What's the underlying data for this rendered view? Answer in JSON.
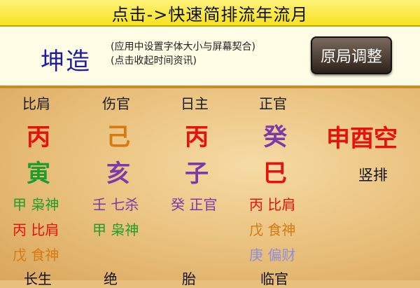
{
  "top_bar": {
    "label": "点击->快速简排流年流月"
  },
  "info_panel": {
    "title": "坤造",
    "note_line1": "(应用中设置字体大小与屏幕契合)",
    "note_line2": "(点击收起时间资讯)",
    "adjust_button": "原局调整"
  },
  "pillars": [
    {
      "header": "比肩",
      "stem": {
        "char": "丙",
        "color": "#e8110c"
      },
      "branch": {
        "char": "寅",
        "color": "#1f9d2a"
      },
      "hidden": [
        {
          "text": "甲 枭神",
          "color": "#1f9d2a"
        },
        {
          "text": "丙 比肩",
          "color": "#e8110c"
        },
        {
          "text": "戊 食神",
          "color": "#d87a12"
        }
      ],
      "stage": "长生"
    },
    {
      "header": "伤官",
      "stem": {
        "char": "己",
        "color": "#d87a12"
      },
      "branch": {
        "char": "亥",
        "color": "#7a3aa8"
      },
      "hidden": [
        {
          "text": "壬 七杀",
          "color": "#7a3aa8"
        },
        {
          "text": "甲 枭神",
          "color": "#1f9d2a"
        }
      ],
      "stage": "绝"
    },
    {
      "header": "日主",
      "stem": {
        "char": "丙",
        "color": "#e8110c"
      },
      "branch": {
        "char": "子",
        "color": "#7a3aa8"
      },
      "hidden": [
        {
          "text": "癸 正官",
          "color": "#7a3aa8"
        }
      ],
      "stage": "胎"
    },
    {
      "header": "正官",
      "stem": {
        "char": "癸",
        "color": "#7a3aa8"
      },
      "branch": {
        "char": "巳",
        "color": "#e8110c"
      },
      "hidden": [
        {
          "text": "丙 比肩",
          "color": "#e8110c"
        },
        {
          "text": "戊 食神",
          "color": "#d87a12"
        },
        {
          "text": "庚 偏财",
          "color": "#8f8fe0"
        }
      ],
      "stage": "临官"
    }
  ],
  "void_label": "申酉空",
  "vertical_button": "竖排"
}
